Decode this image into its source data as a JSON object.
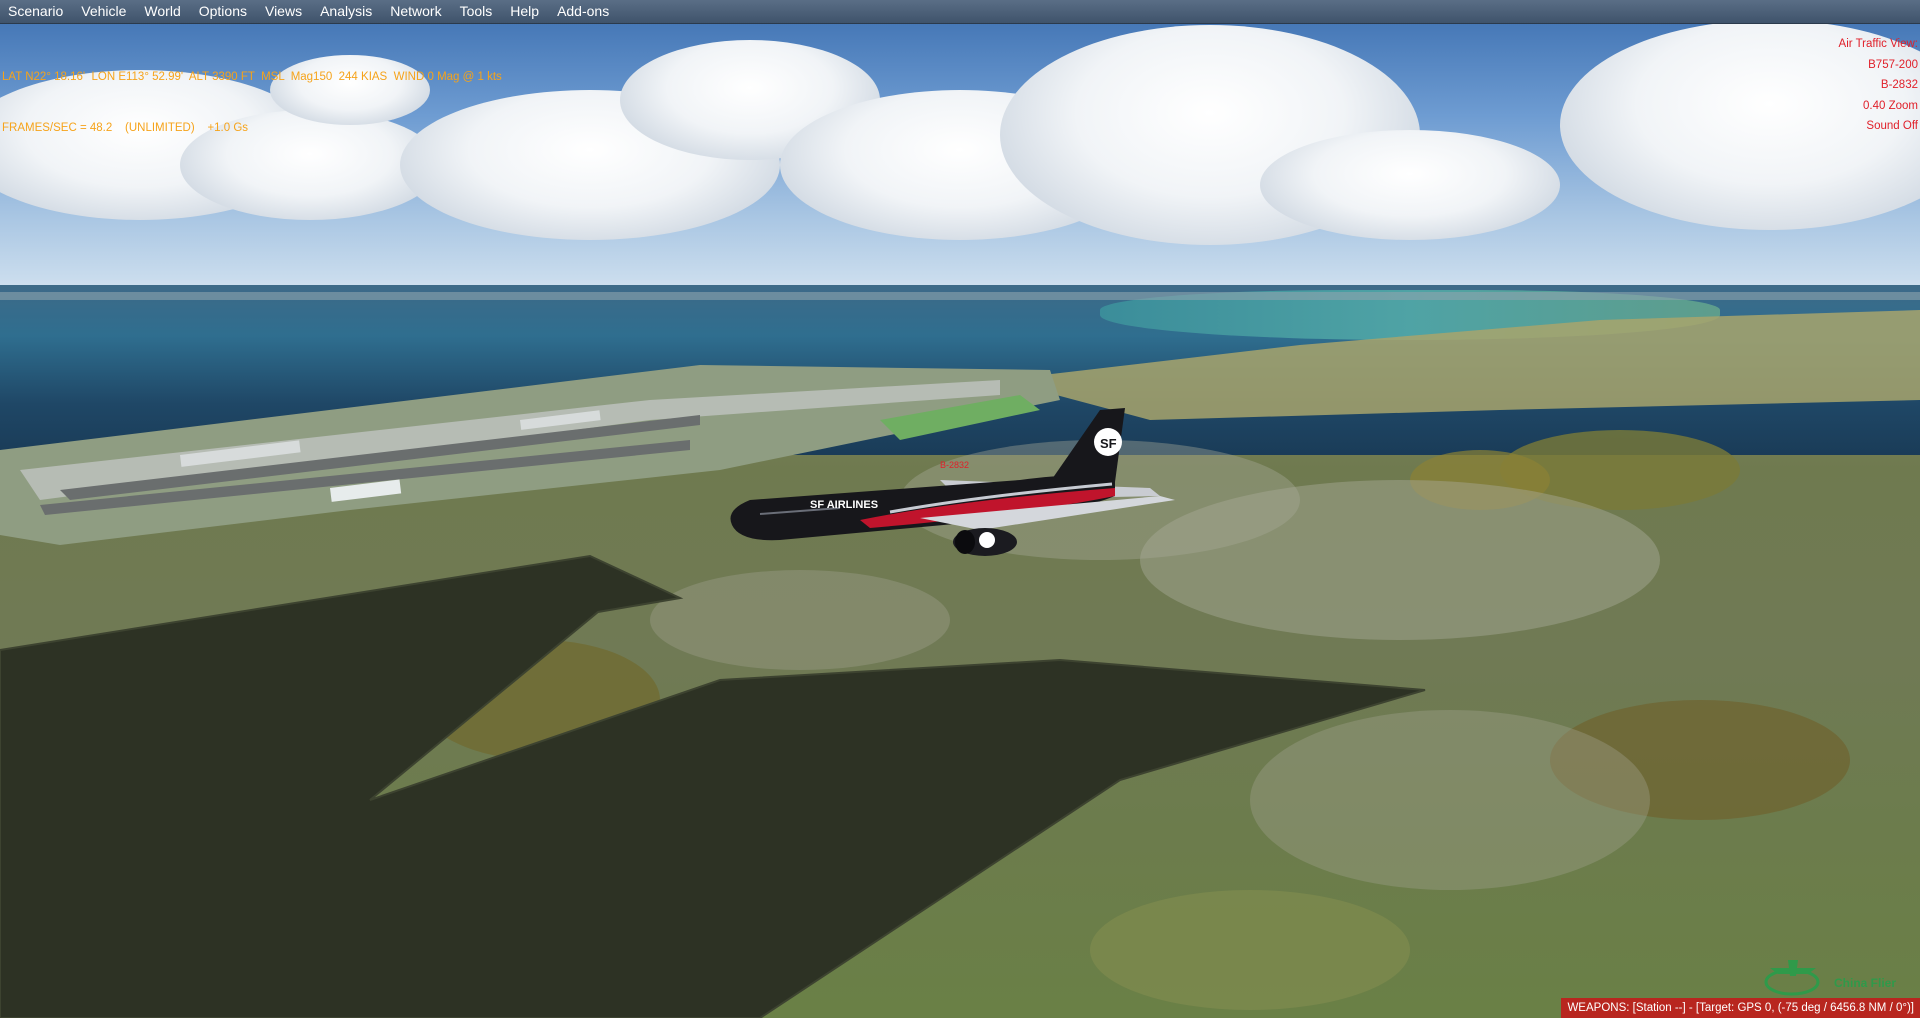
{
  "menu": {
    "items": [
      {
        "label": "Scenario"
      },
      {
        "label": "Vehicle"
      },
      {
        "label": "World"
      },
      {
        "label": "Options"
      },
      {
        "label": "Views"
      },
      {
        "label": "Analysis"
      },
      {
        "label": "Network"
      },
      {
        "label": "Tools"
      },
      {
        "label": "Help"
      },
      {
        "label": "Add-ons"
      }
    ]
  },
  "hud": {
    "position_line": "LAT N22° 18.16'  LON E113° 52.99'  ALT 3390 FT  MSL  Mag150  244 KIAS  WIND 0 Mag @ 1 kts",
    "perf_line": "FRAMES/SEC = 48.2    (UNLIMITED)    +1.0 Gs",
    "view_title": "Air Traffic View:",
    "aircraft_type": "B757-200",
    "registration": "B-2832",
    "zoom": "0.40 Zoom",
    "sound": "Sound Off",
    "aircraft_label": "B-2832"
  },
  "status": {
    "weapons": "WEAPONS: [Station --] - [Target: GPS 0, (-75 deg / 6456.8 NM / 0°)]"
  },
  "watermark": {
    "text": "China Flier",
    "icon": "airplane-globe-icon"
  },
  "aircraft": {
    "livery_text": "SF AIRLINES",
    "tail_logo": "SF"
  },
  "colors": {
    "hud_text": "#f6a31a",
    "view_text": "#e0202a",
    "weapons_bar": "#b8261f",
    "watermark": "#2f9a4a"
  }
}
